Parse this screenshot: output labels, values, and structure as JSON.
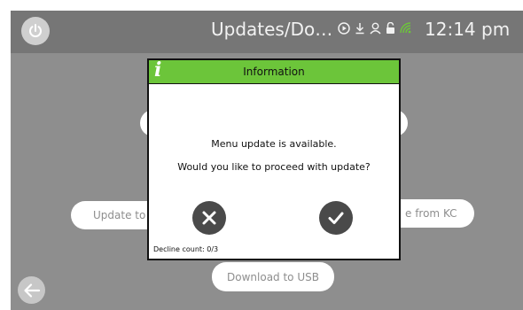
{
  "topbar": {
    "title": "Updates/Do…",
    "time": "12:14 pm"
  },
  "icons": {
    "power": "power-icon",
    "play": "play-circle-icon",
    "download": "download-icon",
    "user": "user-icon",
    "lock": "unlock-icon",
    "wifi": "wifi-icon",
    "back": "arrow-left-icon"
  },
  "background_buttons": {
    "update_to": "Update to",
    "from_kc": "e from KC",
    "download_usb": "Download to USB"
  },
  "dialog": {
    "title": "Information",
    "message_line1": "Menu update is available.",
    "message_line2": "Would you like to proceed with update?",
    "decline_count": "Decline count: 0/3"
  },
  "colors": {
    "header_green": "#6cc53a",
    "screen_gray": "#8e8e8e",
    "topbar_gray": "#767676",
    "button_dark": "#4a4a4a"
  }
}
